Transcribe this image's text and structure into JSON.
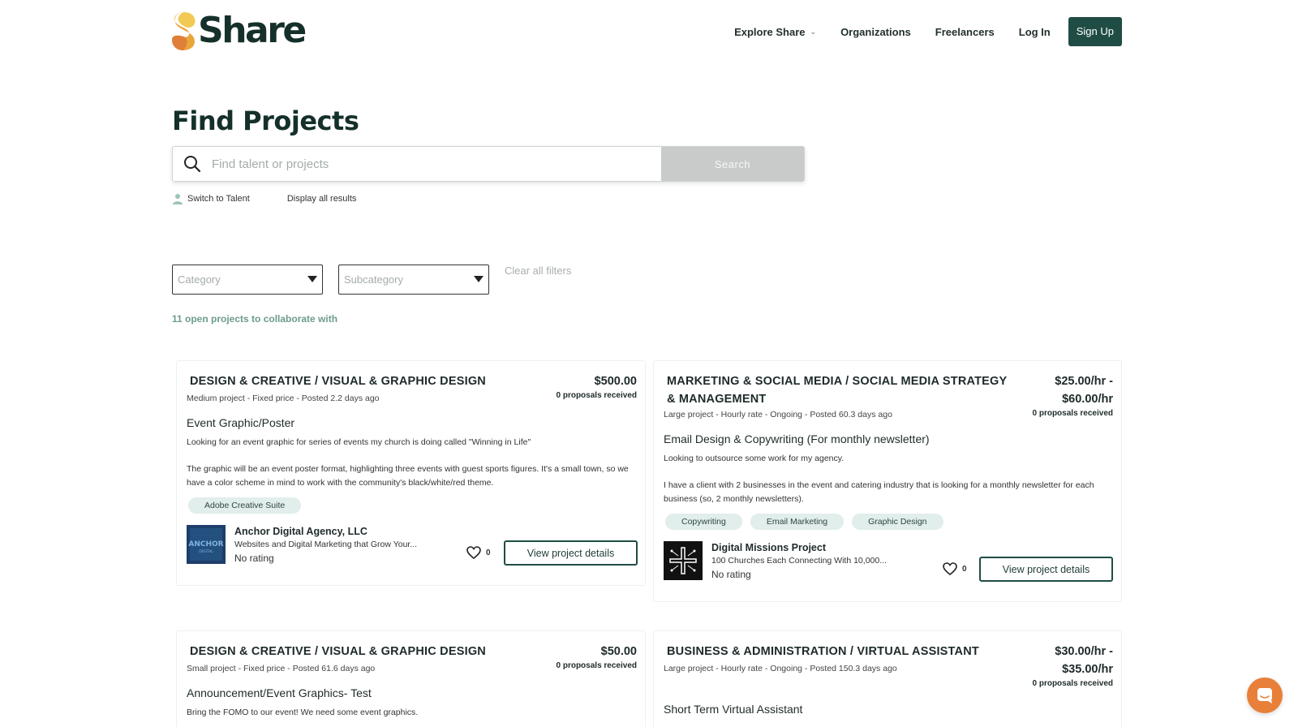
{
  "brand": {
    "name": "Share"
  },
  "nav": {
    "explore": "Explore Share",
    "organizations": "Organizations",
    "freelancers": "Freelancers",
    "login": "Log In",
    "signup": "Sign Up"
  },
  "page": {
    "title": "Find Projects"
  },
  "search": {
    "placeholder": "Find talent or projects",
    "value": "",
    "button": "Search",
    "switch_label": "Switch to Talent",
    "display_all": "Display all results"
  },
  "filters": {
    "category": "Category",
    "subcategory": "Subcategory",
    "clear": "Clear all filters"
  },
  "results": {
    "count_text": "11 open projects to collaborate with"
  },
  "projects": [
    {
      "category": "DESIGN & CREATIVE / VISUAL & GRAPHIC DESIGN",
      "price": "$500.00",
      "proposals": "0 proposals received",
      "meta": "Medium project - Fixed price - Posted 2.2 days ago",
      "title": "Event Graphic/Poster",
      "desc1": "Looking for an event graphic for series of events my church is doing called \"Winning in Life\"",
      "desc2": "The graphic will be an event poster format, highlighting three events with guest sports figures. It's a small town, so we have a color scheme in mind to work with the community's black/white/red theme.",
      "tags": [
        "Adobe Creative Suite"
      ],
      "org_name": "Anchor Digital Agency, LLC",
      "org_tagline": "Websites and Digital Marketing that Grow Your...",
      "org_rating": "No rating",
      "likes": "0",
      "button": "View project details"
    },
    {
      "category": "MARKETING & SOCIAL MEDIA / SOCIAL MEDIA STRATEGY & MANAGEMENT",
      "price": "$25.00/hr - $60.00/hr",
      "proposals": "0 proposals received",
      "meta": "Large project - Hourly rate - Ongoing - Posted 60.3 days ago",
      "title": "Email Design & Copywriting (For monthly newsletter)",
      "desc1": "Looking to outsource some work for my agency.",
      "desc2": "I have a client with 2 businesses in the event and catering industry that is looking for a monthly newsletter for each business (so, 2 monthly newsletters).",
      "tags": [
        "Copywriting",
        "Email Marketing",
        "Graphic Design"
      ],
      "org_name": "Digital Missions Project",
      "org_tagline": "100 Churches Each Connecting With 10,000...",
      "org_rating": "No rating",
      "likes": "0",
      "button": "View project details"
    },
    {
      "category": "DESIGN & CREATIVE / VISUAL & GRAPHIC DESIGN",
      "price": "$50.00",
      "proposals": "0 proposals received",
      "meta": "Small project - Fixed price - Posted 61.6 days ago",
      "title": "Announcement/Event Graphics- Test",
      "desc1": "Bring the FOMO to our event! We need some event graphics."
    },
    {
      "category": "BUSINESS & ADMINISTRATION / VIRTUAL ASSISTANT",
      "price": "$30.00/hr - $35.00/hr",
      "proposals": "0 proposals received",
      "meta": "Large project - Hourly rate - Ongoing - Posted 150.3 days ago",
      "title": "Short Term Virtual Assistant"
    }
  ],
  "colors": {
    "brand_dark": "#1f4d46",
    "brand_text": "#15302b",
    "accent_teal": "#6c9b8f",
    "tag_bg": "#e1eeeb",
    "chat": "#e8803a"
  }
}
